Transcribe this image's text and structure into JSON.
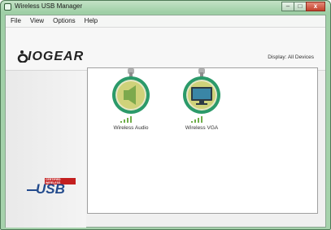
{
  "window": {
    "title": "Wireless USB Manager"
  },
  "menu": [
    "File",
    "View",
    "Options",
    "Help"
  ],
  "header": {
    "brand": "IOGEAR",
    "display_label": "Display: All Devices"
  },
  "sidebar": {
    "usb_logo_text": "USB",
    "usb_badge": "CERTIFIED WIRELESS"
  },
  "devices": [
    {
      "label": "Wireless Audio",
      "icon": "speaker-icon",
      "signal_level": 1.0
    },
    {
      "label": "Wireless VGA",
      "icon": "monitor-icon",
      "signal_level": 1.0
    }
  ],
  "colors": {
    "titlebar": "#a6d2ac",
    "accent": "#2b9a6a",
    "usb_blue": "#234b8d"
  }
}
